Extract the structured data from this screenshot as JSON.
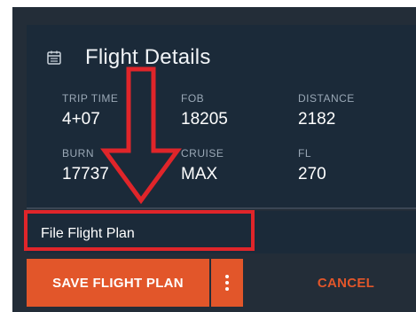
{
  "card": {
    "title": "Flight Details",
    "icon": "calendar-icon",
    "stats": [
      {
        "label": "TRIP TIME",
        "value": "4+07"
      },
      {
        "label": "FOB",
        "value": "18205"
      },
      {
        "label": "DISTANCE",
        "value": "2182"
      },
      {
        "label": "BURN",
        "value": "17737"
      },
      {
        "label": "CRUISE",
        "value": "MAX"
      },
      {
        "label": "FL",
        "value": "270"
      }
    ]
  },
  "menu": {
    "file_flight_plan": "File Flight Plan"
  },
  "actions": {
    "save_label": "SAVE FLIGHT PLAN",
    "more_icon": "kebab-menu-icon",
    "cancel_label": "CANCEL"
  },
  "colors": {
    "accent": "#e2562a",
    "panel": "#1b2a39",
    "background": "#232d38",
    "annotation": "#e0252a"
  }
}
